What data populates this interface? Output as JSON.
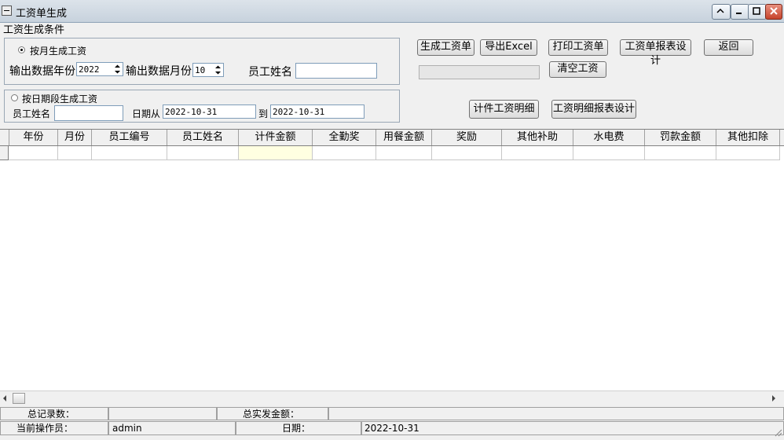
{
  "window": {
    "title": "工资单生成"
  },
  "conditions": {
    "group_label": "工资生成条件",
    "by_month": {
      "radio_label": "按月生成工资",
      "year_label": "输出数据年份",
      "year_value": "2022",
      "month_label": "输出数据月份",
      "month_value": "10",
      "employee_label": "员工姓名",
      "employee_value": ""
    },
    "by_date": {
      "radio_label": "按日期段生成工资",
      "employee_label": "员工姓名",
      "employee_value": "",
      "from_label": "日期从",
      "from_value": "2022-10-31",
      "to_label": "到",
      "to_value": "2022-10-31"
    }
  },
  "buttons": {
    "generate": "生成工资单",
    "export": "导出Excel",
    "print": "打印工资单",
    "design_report": "工资单报表设计",
    "back": "返回",
    "clear": "清空工资",
    "piece_detail": "计件工资明细",
    "detail_design": "工资明细报表设计"
  },
  "grid": {
    "columns": [
      "年份",
      "月份",
      "员工编号",
      "员工姓名",
      "计件金额",
      "全勤奖",
      "用餐金额",
      "奖励",
      "其他补助",
      "水电费",
      "罚款金额",
      "其他扣除"
    ]
  },
  "status": {
    "total_records_label": "总记录数：",
    "total_records_value": "",
    "total_paid_label": "总实发金额：",
    "total_paid_value": "",
    "operator_label": "当前操作员：",
    "operator_value": "admin",
    "date_label": "日期：",
    "date_value": "2022-10-31"
  },
  "colors": {
    "title_bg": "#c7d2dd",
    "highlight_cell": "#ffffe1",
    "close_btn": "#c6442c"
  }
}
